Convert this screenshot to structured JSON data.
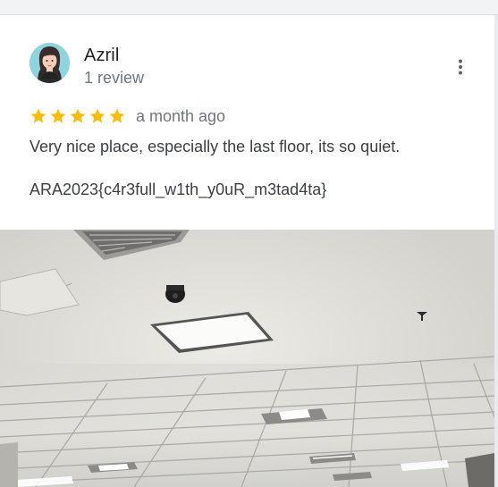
{
  "review": {
    "author_name": "Azril",
    "author_meta": "1 review",
    "rating": 5,
    "rating_max": 5,
    "date": "a month ago",
    "text_line1": "Very nice place, especially the last floor, its so quiet.",
    "text_line2": "ARA2023{c4r3full_w1th_y0uR_m3tad4ta}"
  },
  "colors": {
    "star": "#fbbc04",
    "name": "#202124",
    "meta": "#70757a",
    "text": "#3c4043"
  },
  "icons": {
    "more": "more-vert-icon",
    "star": "star-icon",
    "avatar": "avatar"
  }
}
